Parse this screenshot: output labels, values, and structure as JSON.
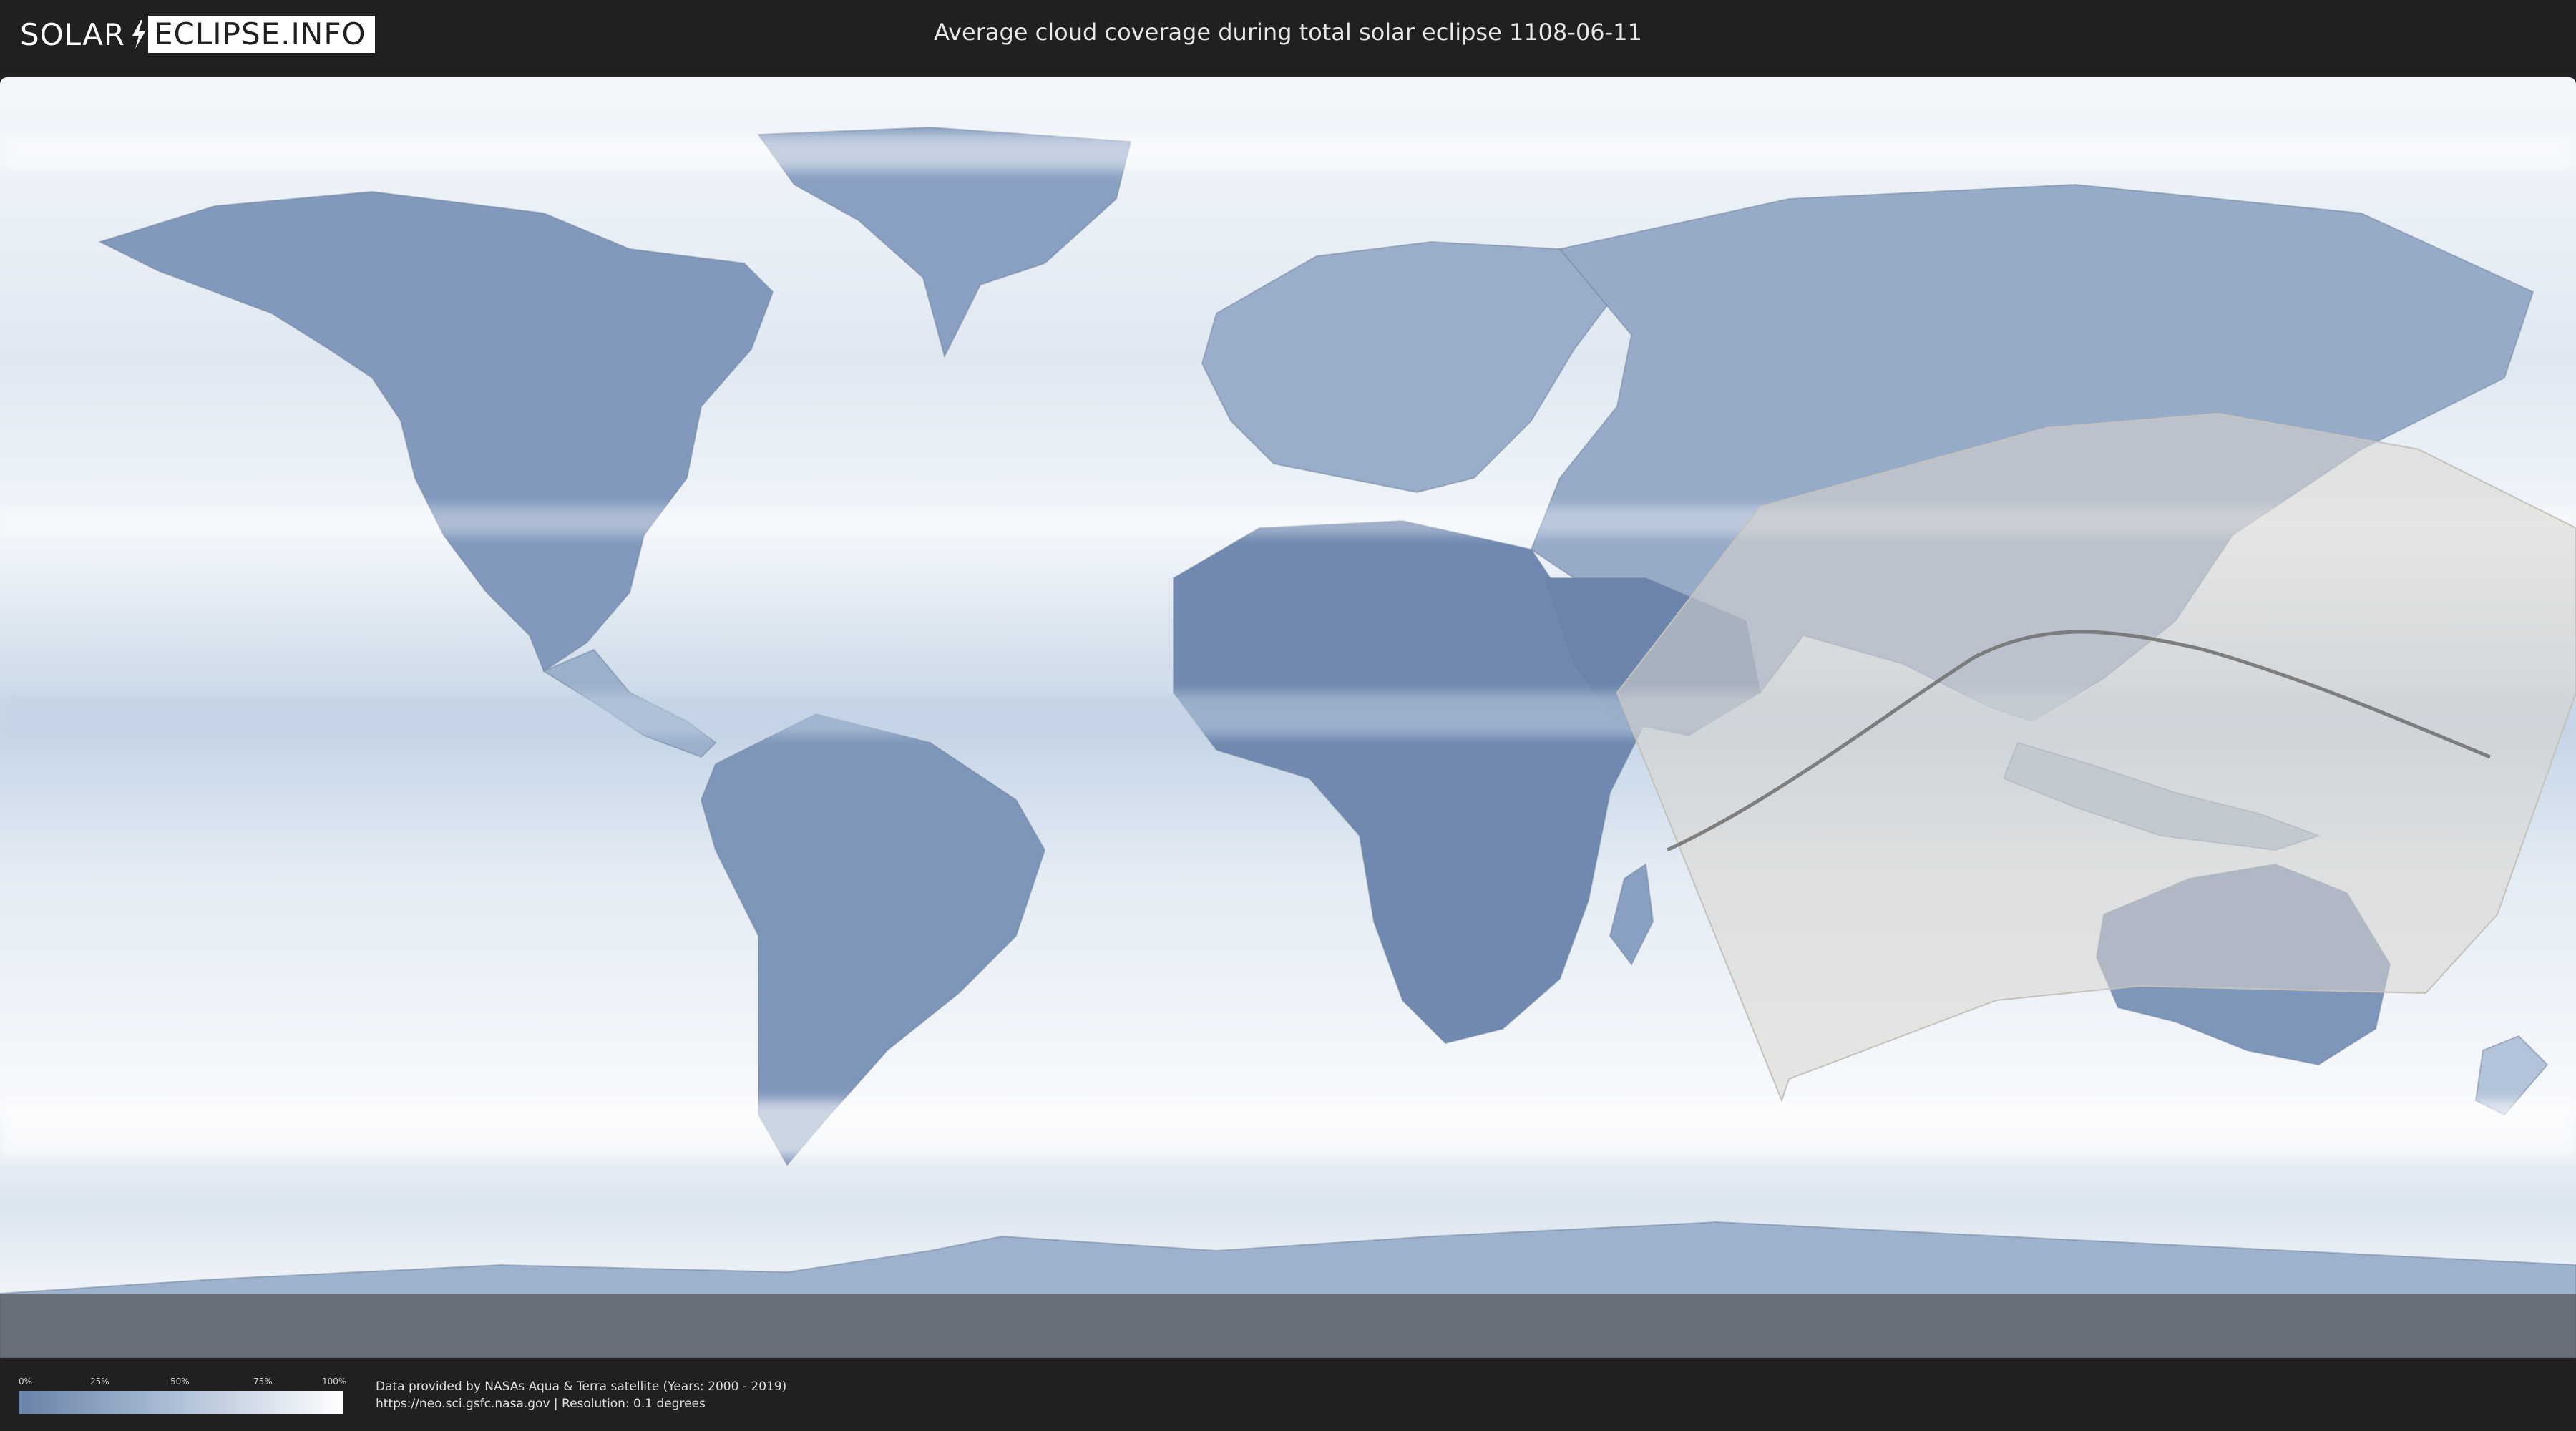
{
  "header": {
    "logo_left": "SOLAR",
    "logo_right": "ECLIPSE.INFO",
    "title": "Average cloud coverage during total solar eclipse 1108-06-11"
  },
  "legend": {
    "ticks": [
      "0%",
      "25%",
      "50%",
      "75%",
      "100%"
    ],
    "colors": {
      "low": "#6a82a8",
      "high": "#ffffff"
    }
  },
  "credit": {
    "line1": "Data provided by NASAs Aqua & Terra satellite (Years: 2000 - 2019)",
    "line2": "https://neo.sci.gsfc.nasa.gov | Resolution: 0.1 degrees"
  },
  "map": {
    "projection": "equirectangular",
    "colors": {
      "ocean_cloud": "#eef3f9",
      "land_clear": "#6f86ad",
      "eclipse_zone": "#d8d6d0",
      "path": "#6e6e6e"
    }
  }
}
